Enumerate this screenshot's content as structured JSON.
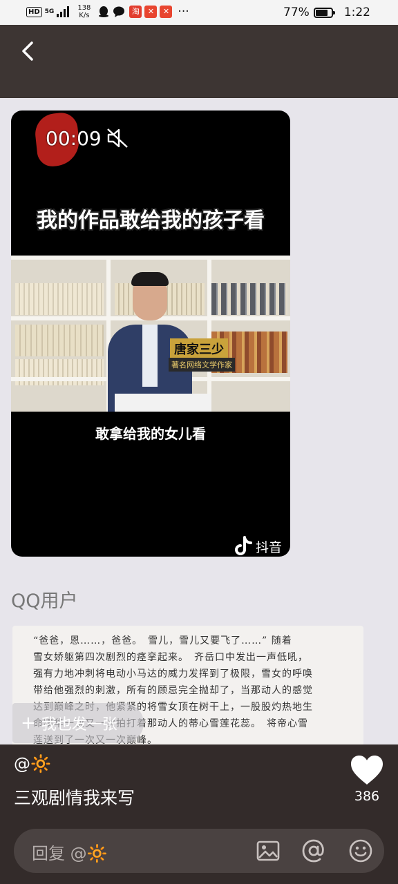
{
  "status_bar": {
    "hd": "HD",
    "network": "5G",
    "speed_value": "138",
    "speed_unit": "K/s",
    "app_icons": [
      "qq-icon",
      "wechat-icon",
      "taobao-icon",
      "app-icon-1",
      "app-icon-2"
    ],
    "taobao_glyph": "淘",
    "more": "···",
    "battery_percent": "77%",
    "battery_level": 0.77,
    "time": "1:22"
  },
  "header": {
    "back_icon": "chevron-left-icon"
  },
  "video": {
    "time": "00:09",
    "caption_top": "我的作品敢给我的孩子看",
    "name_tag": "唐家三少",
    "name_sub": "著名网络文学作家",
    "subtitle": "敢拿给我的女儿看",
    "watermark": "抖音"
  },
  "post": {
    "username": "QQ用户",
    "text_image_lines": [
      "“爸爸，恩……，爸爸。　雪儿，雪儿又要飞了……” 随着",
      "雪女娇躯第四次剧烈的痉挛起来。　齐岳口中发出一声低吼，",
      "强有力地冲刺将电动小马达的威力发挥到了极限，雪女的呼唤",
      "带给他强烈的刺激，所有的顾忌完全抛却了，当那动人的感觉",
      "达到巅峰之时，他紧紧的将雪女顶在树干上，一股股灼热地生",
      "命精华一次又一次拍打着那动人的蒂心雪莲花蕊。　将帝心雪",
      "莲送到了一次又一次巅峰。"
    ],
    "post_button": "我也发一张",
    "post_button_plus": "+"
  },
  "info": {
    "author_prefix": "@",
    "author_emoji": "🔆",
    "title": "三观剧情我来写",
    "like_count": "386"
  },
  "reply": {
    "placeholder": "回复 @",
    "placeholder_emoji": "🔆"
  },
  "colors": {
    "header_bg": "#3d3533",
    "bar_bg": "#332b2a",
    "content_bg": "#e7e5eb",
    "accent_sun": "#f5a623"
  }
}
